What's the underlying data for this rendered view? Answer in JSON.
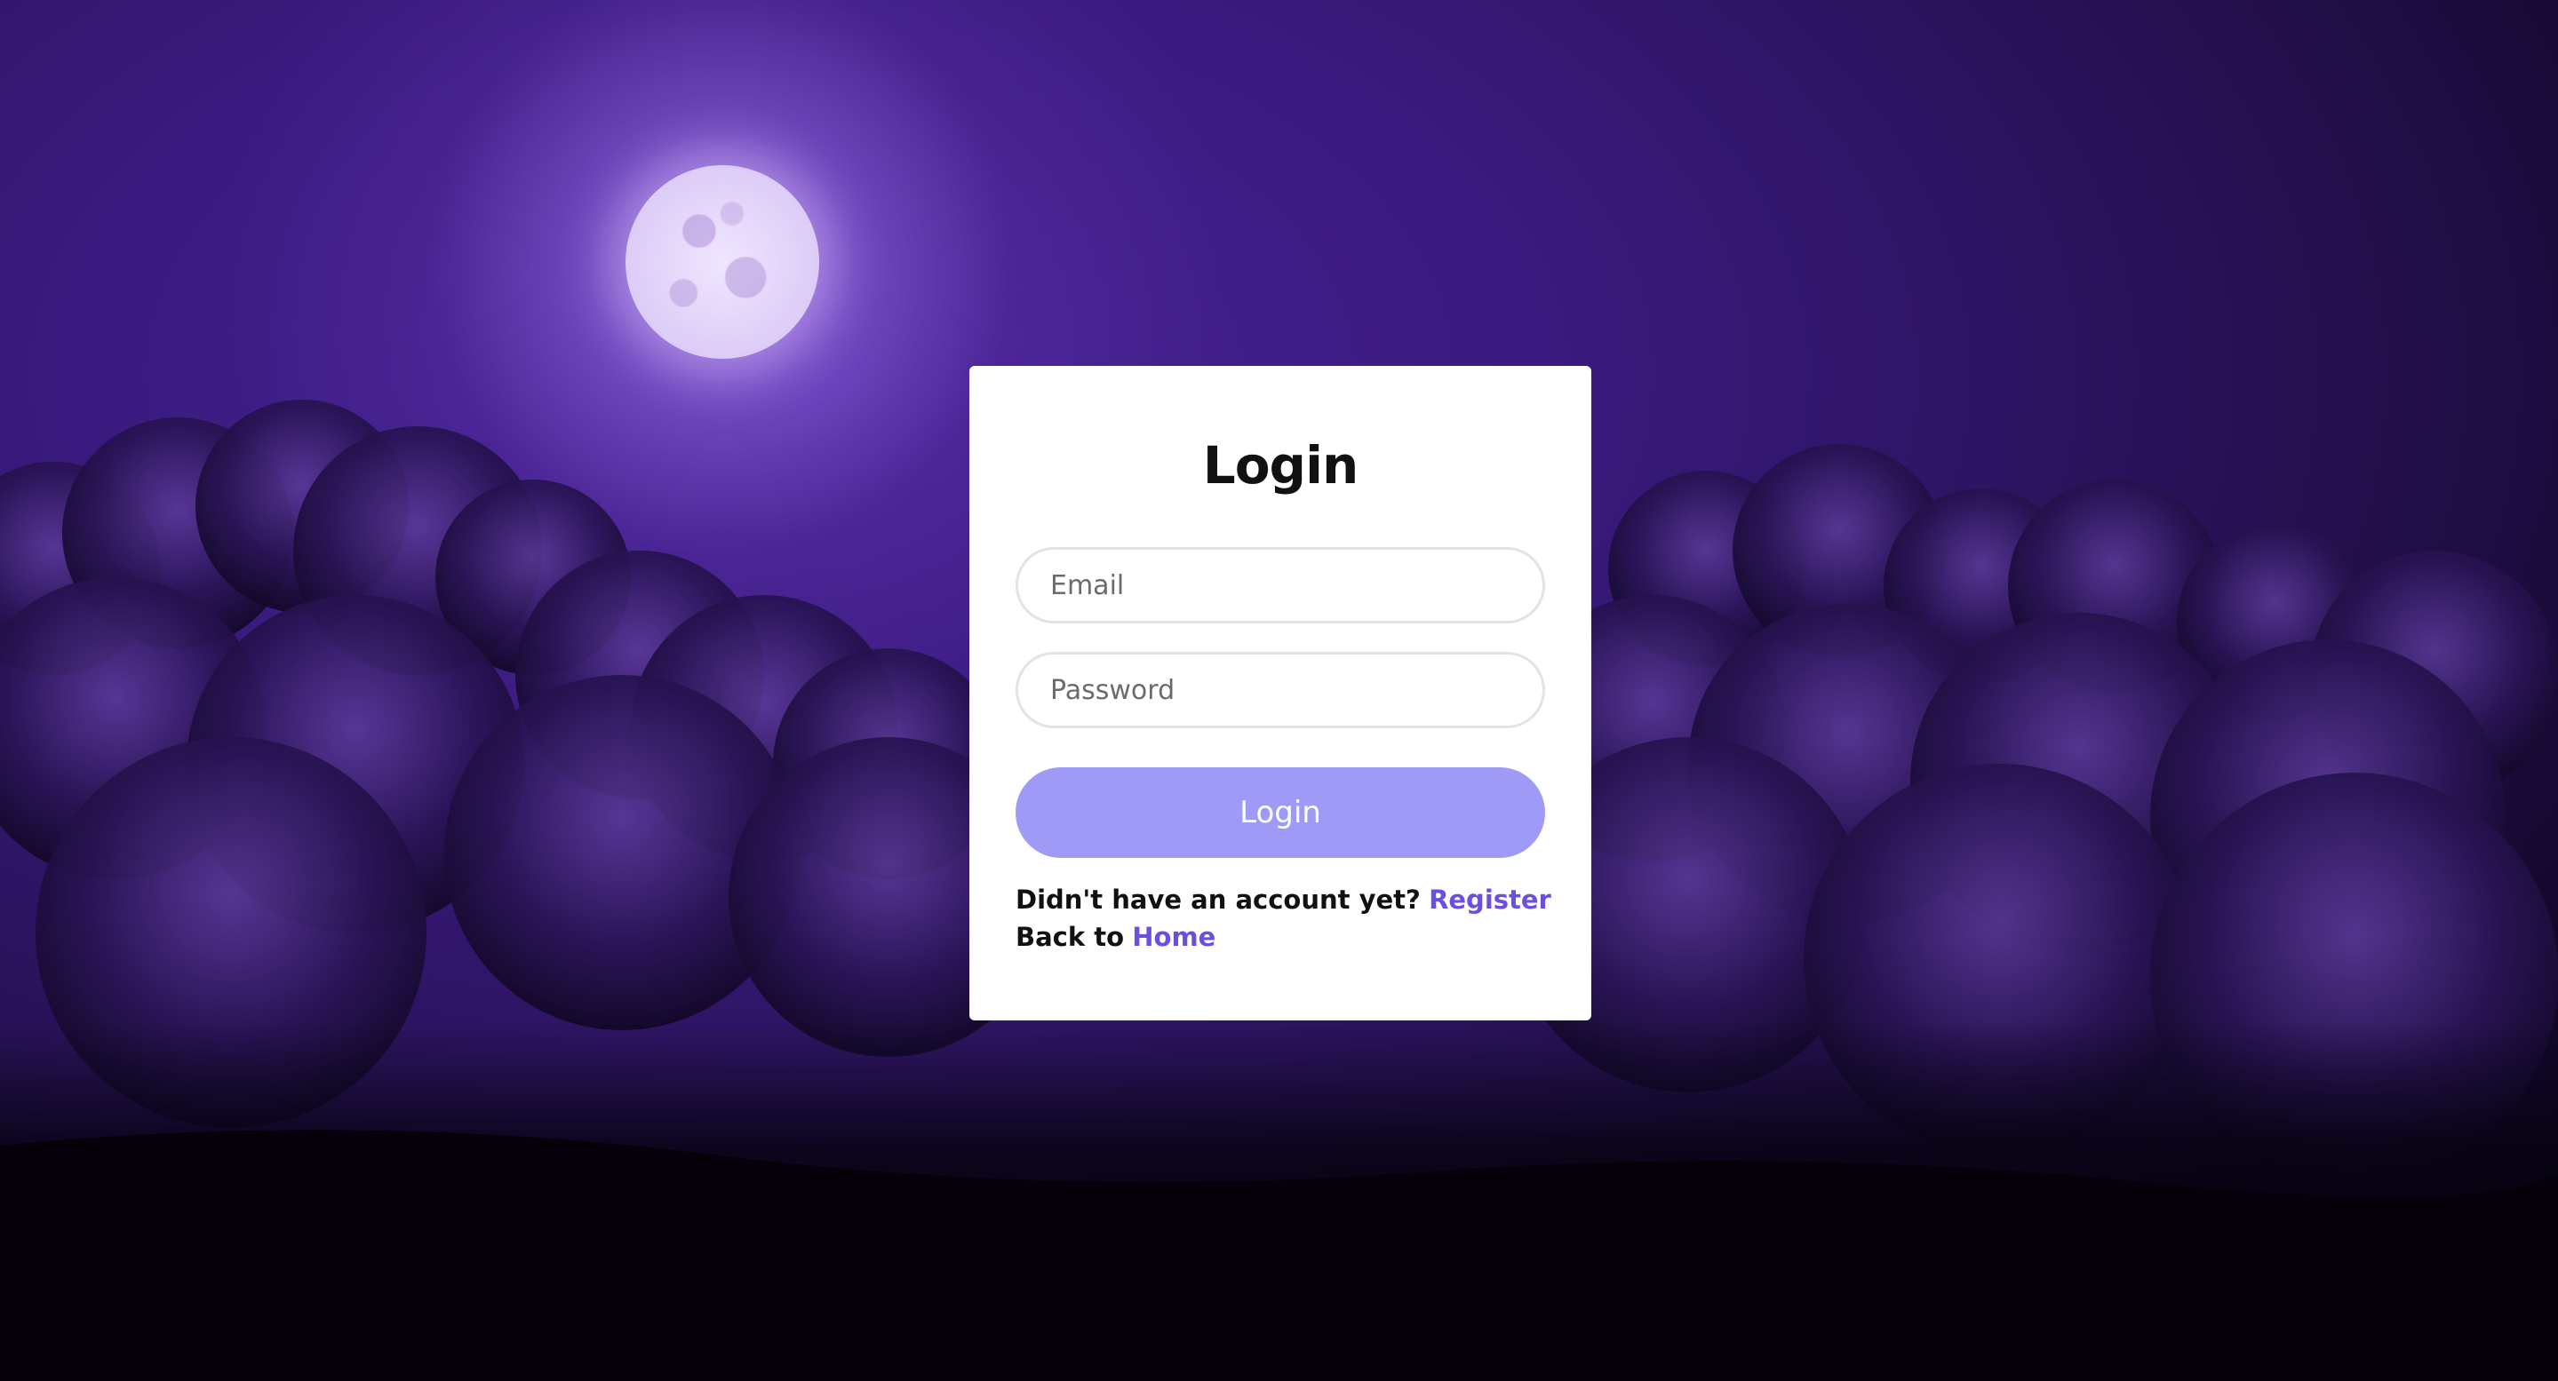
{
  "login": {
    "title": "Login",
    "email_placeholder": "Email",
    "password_placeholder": "Password",
    "button_label": "Login",
    "register_prompt": "Didn't have an account yet?",
    "register_link": "Register",
    "back_prompt": "Back to",
    "home_link": "Home"
  },
  "colors": {
    "button": "#a09af7",
    "link": "#6a4fe0",
    "background_accent": "#3a1a7e"
  }
}
